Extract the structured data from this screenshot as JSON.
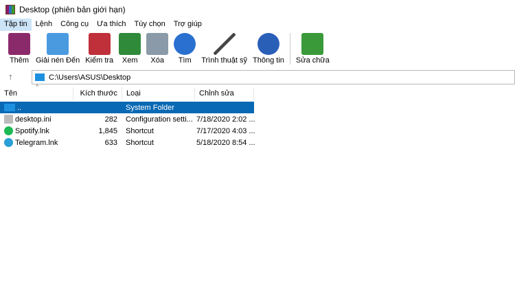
{
  "window": {
    "title": "Desktop (phiên bản giới hạn)"
  },
  "menu": [
    "Tập tin",
    "Lệnh",
    "Công cụ",
    "Ưa thích",
    "Tùy chọn",
    "Trợ giúp"
  ],
  "toolbar": [
    {
      "label": "Thêm",
      "icon": "archive-books-icon",
      "color": "#8b2a6b"
    },
    {
      "label": "Giải nén Đến",
      "icon": "folder-extract-icon",
      "color": "#4a9ae0"
    },
    {
      "label": "Kiểm tra",
      "icon": "clipboard-check-icon",
      "color": "#c0303a"
    },
    {
      "label": "Xem",
      "icon": "open-book-icon",
      "color": "#2f8a3a"
    },
    {
      "label": "Xóa",
      "icon": "trash-icon",
      "color": "#8a9aa8"
    },
    {
      "label": "Tìm",
      "icon": "magnifier-icon",
      "color": "#2a70d0"
    },
    {
      "label": "Trình thuật sỹ",
      "icon": "magic-wand-icon",
      "color": "#444444"
    },
    {
      "label": "Thông tin",
      "icon": "info-icon",
      "color": "#2a5fb8"
    },
    {
      "label": "Sửa chữa",
      "icon": "repair-book-icon",
      "color": "#3a9a3a"
    }
  ],
  "address": {
    "path": "C:\\Users\\ASUS\\Desktop"
  },
  "columns": [
    "Tên",
    "Kích thước",
    "Loại",
    "Chỉnh sửa"
  ],
  "files": [
    {
      "name": "..",
      "size": "",
      "type": "System Folder",
      "modified": "",
      "icon": "folder-up-icon",
      "color": "#1e90e0"
    },
    {
      "name": "desktop.ini",
      "size": "282",
      "type": "Configuration setti...",
      "modified": "7/18/2020 2:02 ...",
      "icon": "settings-file-icon",
      "color": "#bbbbbb"
    },
    {
      "name": "Spotify.lnk",
      "size": "1,845",
      "type": "Shortcut",
      "modified": "7/17/2020 4:03 ...",
      "icon": "spotify-icon",
      "color": "#1db954"
    },
    {
      "name": "Telegram.lnk",
      "size": "633",
      "type": "Shortcut",
      "modified": "5/18/2020 8:54 ...",
      "icon": "telegram-icon",
      "color": "#2a9fd8"
    }
  ],
  "selected_row": 0
}
